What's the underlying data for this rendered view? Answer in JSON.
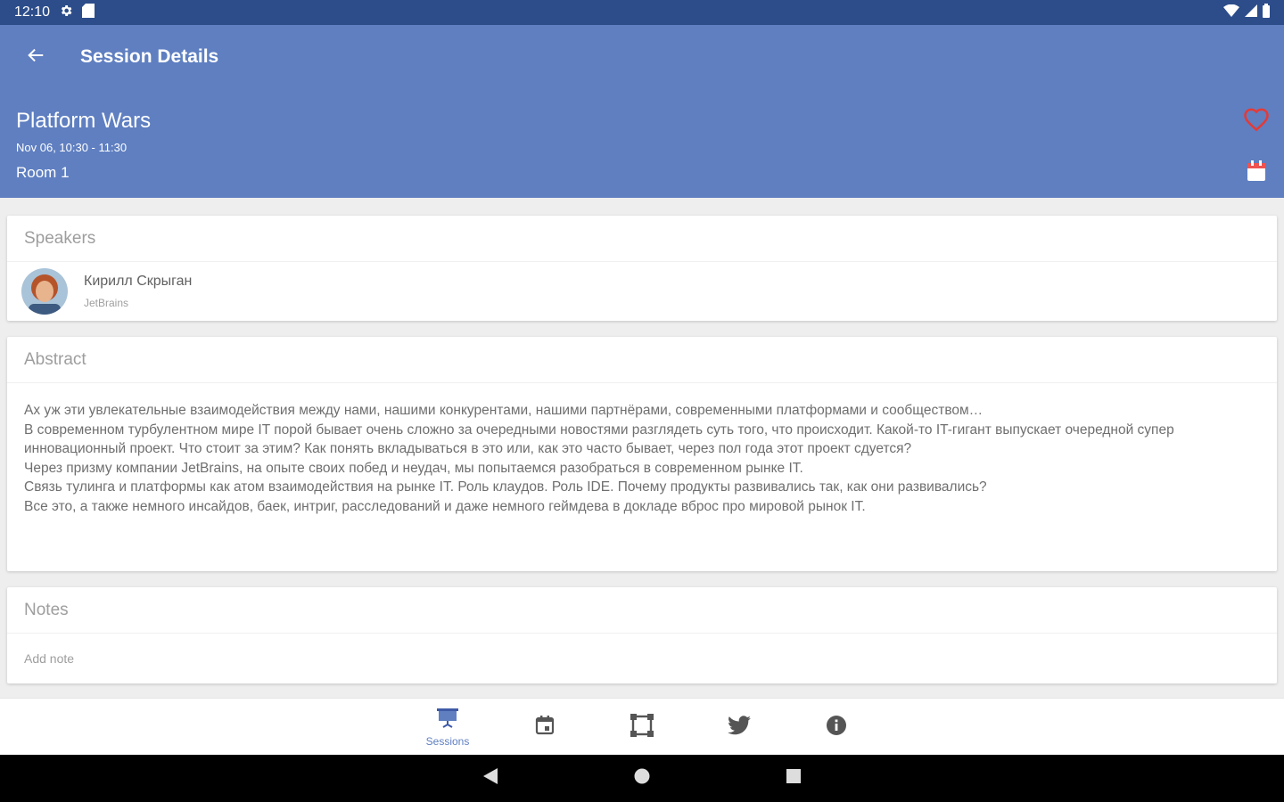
{
  "status_bar": {
    "time": "12:10",
    "icons": [
      "gear-icon",
      "sd-card-icon",
      "wifi-icon",
      "signal-icon",
      "battery-icon"
    ]
  },
  "app_bar": {
    "title": "Session Details",
    "back_icon": "arrow-back-icon"
  },
  "session": {
    "title": "Platform Wars",
    "time": "Nov 06, 10:30 - 11:30",
    "room": "Room 1",
    "favorite_icon": "heart-outline-icon",
    "calendar_icon": "calendar-icon"
  },
  "speakers_section": {
    "title": "Speakers",
    "items": [
      {
        "name": "Кирилл Скрыган",
        "company": "JetBrains"
      }
    ]
  },
  "abstract_section": {
    "title": "Abstract",
    "text": "Ах уж эти увлекательные взаимодействия между нами, нашими конкурентами, нашими партнёрами, современными платформами и сообществом…\nВ современном турбулентном мире IT порой бывает очень сложно за очередными новостями разглядеть суть того, что происходит. Какой-то IT-гигант выпускает очередной супер инновационный проект. Что стоит за этим? Как понять вкладываться в это или, как это часто бывает, через пол года этот проект сдуется?\nЧерез призму компании JetBrains, на опыте своих побед и неудач, мы попытаемся разобраться в современном рынке IT.\nСвязь тулинга и платформы как атом взаимодействия на рынке IT. Роль клаудов. Роль IDE. Почему продукты развивались так, как они развивались?\nВсе это, а также немного инсайдов, баек, интриг, расследований и даже немного геймдева в докладе вброс про мировой рынок IT."
  },
  "notes_section": {
    "title": "Notes",
    "placeholder": "Add note"
  },
  "bottom_nav": {
    "items": [
      {
        "label": "Sessions",
        "icon": "presentation-icon",
        "active": true
      },
      {
        "label": "",
        "icon": "calendar-icon",
        "active": false
      },
      {
        "label": "",
        "icon": "map-icon",
        "active": false
      },
      {
        "label": "",
        "icon": "twitter-icon",
        "active": false
      },
      {
        "label": "",
        "icon": "info-icon",
        "active": false
      }
    ]
  },
  "colors": {
    "primary": "#5f7fc1",
    "status_bar": "#2c4d8a",
    "favorite": "#e53935",
    "nav_icon": "#555555"
  }
}
